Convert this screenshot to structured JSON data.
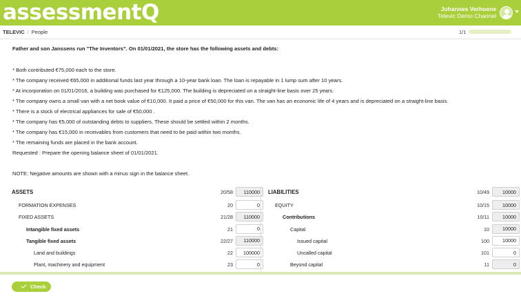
{
  "header": {
    "logo": "assessmentQ",
    "user_name": "Johannes Verhoene",
    "user_channel": "Televic Demo Channel"
  },
  "breadcrumb": {
    "items": [
      "TELEVIC",
      "People"
    ],
    "pager": "1/1",
    "progress_fraction": 0.0
  },
  "question": {
    "title": "Father and son Janssens run \"The Inventors\". On 01/01/2021, the store has the following assets and debts:",
    "lines": [
      "* Both contributed €75,000 each to the store.",
      "* The company received €65,000 in additional funds last year through a 10-year bank loan. The loan is repayable in 1 lump sum after 10 years.",
      "* At incorporation on 01/01/2016, a building was purchased for €125,000. The building is depreciated on a straight-line basis over 25 years.",
      "* The company owns a small van with a net book value of €10,000. It paid a price of €50,000 for this van. The van has an economic life of 4 years and is depreciated on a straight-line basis.",
      "* There is a stock of electrical appliances for sale of €50,000 .",
      "* The company has €5,000 of outstanding debts to suppliers. These should be settled within 2 months.",
      "* The company has €15,000 in receivables from customers that need to be paid within two months.",
      "* The remaining funds are placed in the bank account.",
      "Requested : Prepare the opening balance sheet of 01/01/2021."
    ],
    "note": "NOTE: Negative amounts are shown with a minus sign in the balance sheet."
  },
  "assets": {
    "title": "ASSETS",
    "code": "20/58",
    "value": "110000",
    "rows": [
      {
        "label": "FORMATION EXPENSES",
        "code": "20",
        "value": "0",
        "bold": false,
        "indent": 10,
        "readonly": false
      },
      {
        "label": "FIXED ASSETS",
        "code": "21/28",
        "value": "110000",
        "bold": false,
        "indent": 10,
        "readonly": true
      },
      {
        "label": "Intangible fixed assets",
        "code": "21",
        "value": "0",
        "bold": true,
        "indent": 21,
        "readonly": false
      },
      {
        "label": "Tangible fixed assets",
        "code": "22/27",
        "value": "110000",
        "bold": true,
        "indent": 21,
        "readonly": true
      },
      {
        "label": "Land and buildings",
        "code": "22",
        "value": "100000",
        "bold": false,
        "indent": 32,
        "readonly": false
      },
      {
        "label": "Plant, machinery and equipment",
        "code": "23",
        "value": "0",
        "bold": false,
        "indent": 32,
        "readonly": false
      }
    ]
  },
  "liabilities": {
    "title": "LIABILITIES",
    "code": "10/49",
    "value": "10000",
    "rows": [
      {
        "label": "EQUITY",
        "code": "10/15",
        "value": "10000",
        "bold": false,
        "indent": 10,
        "readonly": true
      },
      {
        "label": "Contributions",
        "code": "10/11",
        "value": "10000",
        "bold": true,
        "indent": 21,
        "readonly": true
      },
      {
        "label": "Capital",
        "code": "10",
        "value": "10000",
        "bold": false,
        "indent": 32,
        "readonly": true
      },
      {
        "label": "Issued capital",
        "code": "100",
        "value": "10000",
        "bold": false,
        "indent": 42,
        "readonly": false
      },
      {
        "label": "Uncalled capital",
        "code": "101",
        "value": "0",
        "bold": false,
        "indent": 42,
        "readonly": false
      },
      {
        "label": "Beyond capital",
        "code": "11",
        "value": "0",
        "bold": false,
        "indent": 32,
        "readonly": true
      }
    ]
  },
  "footer": {
    "check_label": "Check"
  },
  "colors": {
    "brand": "#a9cf3a"
  }
}
